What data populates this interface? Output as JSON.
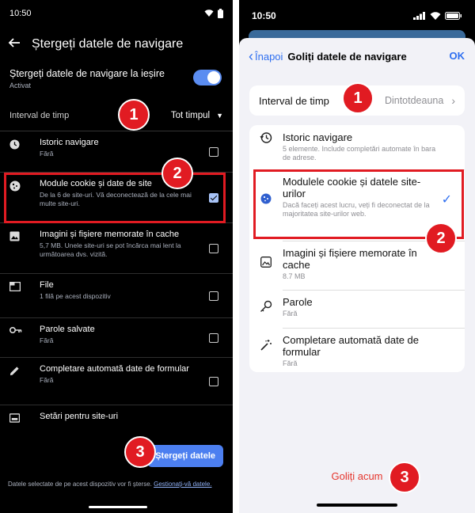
{
  "android": {
    "status_time": "10:50",
    "title": "Ștergeți datele de navigare",
    "exit": {
      "label": "Ștergeți datele de navigare la ieșire",
      "state": "Activat"
    },
    "time_range": {
      "label": "Interval de timp",
      "value": "Tot timpul"
    },
    "items": [
      {
        "title": "Istoric navigare",
        "desc": "Fără",
        "icon": "clock-icon",
        "checked": false
      },
      {
        "title": "Module cookie și date de site",
        "desc": "De la 6 de site-uri. Vă deconectează de la cele mai multe site-uri.",
        "icon": "cookie-icon",
        "checked": true
      },
      {
        "title": "Imagini și fișiere memorate în cache",
        "desc": "5,7 MB. Unele site-uri se pot încărca mai lent la următoarea dvs. vizită.",
        "icon": "image-icon",
        "checked": false
      },
      {
        "title": "File",
        "desc": "1 filă pe acest dispozitiv",
        "icon": "tab-icon",
        "checked": false
      },
      {
        "title": "Parole salvate",
        "desc": "Fără",
        "icon": "key-icon",
        "checked": false
      },
      {
        "title": "Completare automată date de formular",
        "desc": "Fără",
        "icon": "pencil-icon",
        "checked": false
      },
      {
        "title": "Setări pentru site-uri",
        "desc": "",
        "icon": "settings-icon",
        "checked": false
      }
    ],
    "clear_button": "Ștergeți datele",
    "footer_text": "Datele selectate de pe acest dispozitiv vor fi șterse.",
    "footer_link": "Gestionați-vă datele."
  },
  "ios": {
    "status_time": "10:50",
    "back_label": "Înapoi",
    "title": "Goliți datele de navigare",
    "ok_label": "OK",
    "time_range": {
      "label": "Interval de timp",
      "value": "Dintotdeauna"
    },
    "items": [
      {
        "title": "Istoric navigare",
        "desc": "5 elemente. Include completări automate în bara de adrese.",
        "icon": "history-icon",
        "checked": false
      },
      {
        "title": "Modulele cookie și datele site-urilor",
        "desc": "Dacă faceți acest lucru, veți fi deconectat de la majoritatea site-urilor web.",
        "icon": "cookie-icon",
        "checked": true
      },
      {
        "title": "Imagini și fișiere memorate în cache",
        "desc": "8.7 MB",
        "icon": "image-icon",
        "checked": false
      },
      {
        "title": "Parole",
        "desc": "Fără",
        "icon": "key-icon",
        "checked": false
      },
      {
        "title": "Completare automată date de formular",
        "desc": "Fără",
        "icon": "magic-wand-icon",
        "checked": false
      }
    ],
    "clear_label": "Goliți acum"
  },
  "markers": {
    "a1": "1",
    "a2": "2",
    "a3": "3",
    "i1": "1",
    "i2": "2",
    "i3": "3"
  },
  "colors": {
    "marker": "#e11b22",
    "android_accent": "#4c7ff0",
    "ios_accent": "#2f6ff0",
    "ios_destructive": "#e5352c"
  }
}
